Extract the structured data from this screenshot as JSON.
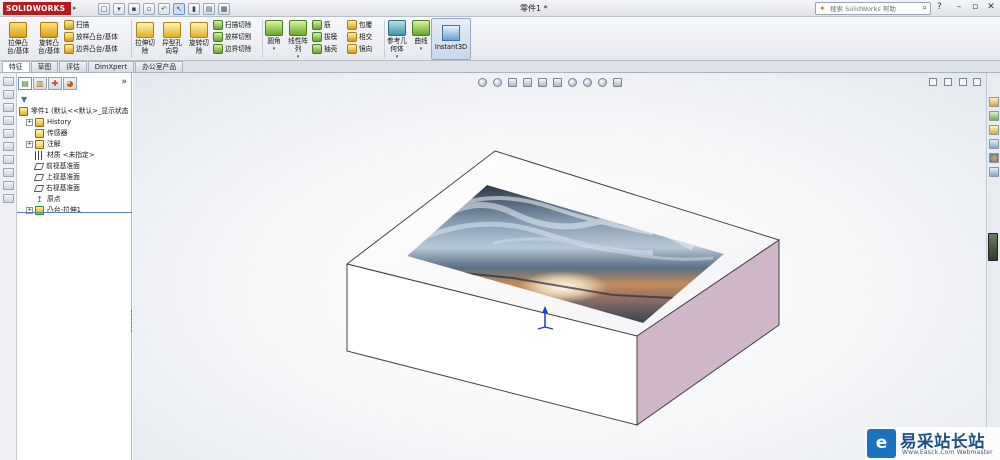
{
  "app": {
    "logo": "SOLIDWORKS",
    "doc_title": "零件1 *"
  },
  "search": {
    "placeholder": "搜索 SolidWorks 帮助"
  },
  "ribbon": {
    "features": [
      {
        "label": "拉伸凸\n台/基体"
      },
      {
        "label": "旋转凸\n台/基体"
      }
    ],
    "small_col1": [
      {
        "label": "扫描"
      },
      {
        "label": "放样凸台/基体"
      },
      {
        "label": "边界凸台/基体"
      }
    ],
    "cuts_big": [
      {
        "label": "拉伸切\n除"
      },
      {
        "label": "异型孔\n向导"
      },
      {
        "label": "旋转切\n除"
      }
    ],
    "small_col2": [
      {
        "label": "扫描切除"
      },
      {
        "label": "放样切割"
      },
      {
        "label": "边界切除"
      }
    ],
    "fillet": {
      "label": "圆角"
    },
    "pattern": {
      "label": "线性阵\n列"
    },
    "small_col3": [
      {
        "label": "筋"
      },
      {
        "label": "拔模"
      },
      {
        "label": "抽壳"
      }
    ],
    "small_col4": [
      {
        "label": "包覆"
      },
      {
        "label": "相交"
      },
      {
        "label": "镜向"
      }
    ],
    "refgeom": {
      "label": "参考几\n何体"
    },
    "curves": {
      "label": "曲线"
    },
    "instant3d": {
      "label": "Instant3D"
    }
  },
  "tabs": [
    {
      "label": "特征",
      "active": true
    },
    {
      "label": "草图",
      "active": false
    },
    {
      "label": "评估",
      "active": false
    },
    {
      "label": "DimXpert",
      "active": false
    },
    {
      "label": "办公室产品",
      "active": false
    }
  ],
  "tree": {
    "root": "零件1 (默认<<默认>_显示状态",
    "items": [
      {
        "label": "History",
        "expand": "+",
        "icon": "history-icon"
      },
      {
        "label": "传感器",
        "expand": "",
        "icon": "sensor-icon"
      },
      {
        "label": "注解",
        "expand": "+",
        "icon": "annotation-icon"
      },
      {
        "label": "材质 <未指定>",
        "expand": "",
        "icon": "material-icon"
      },
      {
        "label": "前视基准面",
        "expand": "",
        "icon": "plane-icon"
      },
      {
        "label": "上视基准面",
        "expand": "",
        "icon": "plane-icon"
      },
      {
        "label": "右视基准面",
        "expand": "",
        "icon": "plane-icon"
      },
      {
        "label": "原点",
        "expand": "",
        "icon": "origin-icon"
      },
      {
        "label": "凸台-拉伸1",
        "expand": "+",
        "icon": "boss-extrude-icon"
      }
    ]
  },
  "colors": {
    "box_top": "#ffffff",
    "box_front": "#ffffff",
    "box_right": "#cfb7c9",
    "box_edge": "#444444",
    "decal_sky": "#6f8aa6",
    "decal_sun": "#fff3d6"
  },
  "watermark": {
    "title": "易采站长站",
    "subtitle": "Www.Easck.Com Webmaster"
  }
}
